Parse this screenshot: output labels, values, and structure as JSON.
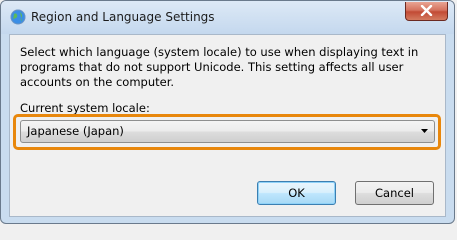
{
  "window": {
    "title": "Region and Language Settings",
    "title_icon": "globe-icon",
    "close_icon": "close-icon"
  },
  "dialog": {
    "description": "Select which language (system locale) to use when displaying text in programs that do not support Unicode. This setting affects all user accounts on the computer.",
    "locale_label": "Current system locale:",
    "locale_value": "Japanese (Japan)",
    "dropdown_icon": "chevron-down-icon",
    "highlight_color": "#e8870c"
  },
  "buttons": {
    "ok": "OK",
    "cancel": "Cancel"
  }
}
